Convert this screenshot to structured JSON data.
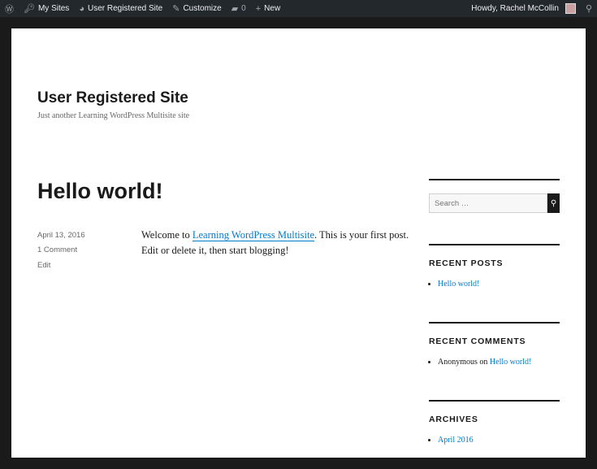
{
  "adminbar": {
    "my_sites": "My Sites",
    "site": "User Registered Site",
    "customize": "Customize",
    "comments": "0",
    "new": "New",
    "howdy": "Howdy, Rachel McCollin"
  },
  "site": {
    "title": "User Registered Site",
    "description": "Just another Learning WordPress Multisite site"
  },
  "post": {
    "title": "Hello world!",
    "date": "April 13, 2016",
    "comments": "1 Comment",
    "edit": "Edit",
    "text_before": "Welcome to ",
    "link": "Learning WordPress Multisite",
    "text_after": ". This is your first post. Edit or delete it, then start blogging!"
  },
  "sidebar": {
    "search_placeholder": "Search …",
    "recent_posts_title": "RECENT POSTS",
    "recent_posts": [
      "Hello world!"
    ],
    "recent_comments_title": "RECENT COMMENTS",
    "comment_author": "Anonymous",
    "comment_on": " on ",
    "comment_post": "Hello world!",
    "archives_title": "ARCHIVES",
    "archives": [
      "April 2016"
    ]
  }
}
